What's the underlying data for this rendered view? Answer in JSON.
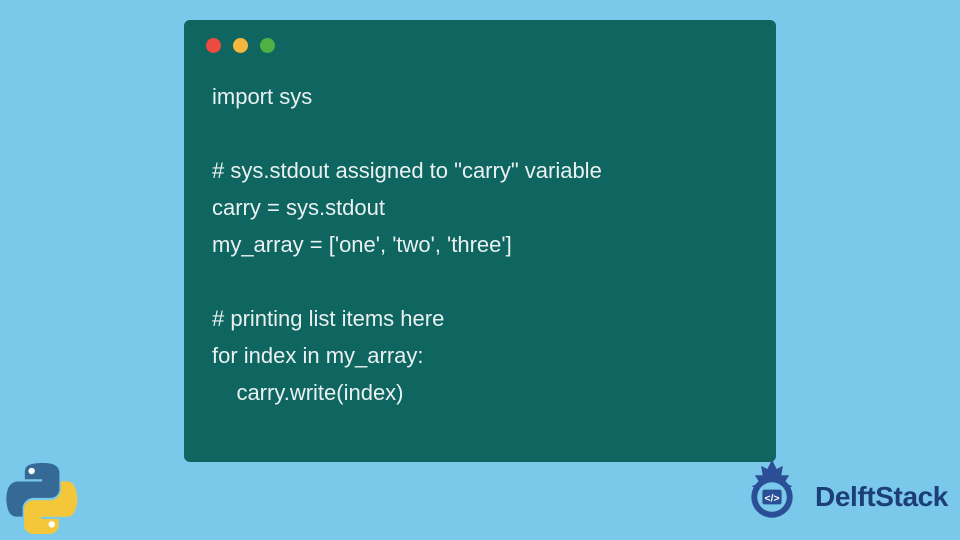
{
  "code": {
    "line1": "import sys",
    "line2": "",
    "line3": "# sys.stdout assigned to \"carry\" variable",
    "line4": "carry = sys.stdout",
    "line5": "my_array = ['one', 'two', 'three']",
    "line6": "",
    "line7": "# printing list items here",
    "line8": "for index in my_array:",
    "line9": "    carry.write(index)"
  },
  "brand": {
    "name": "DelftStack"
  },
  "traffic": {
    "red": "#ed4b41",
    "yellow": "#f6b73e",
    "green": "#4fb143"
  }
}
